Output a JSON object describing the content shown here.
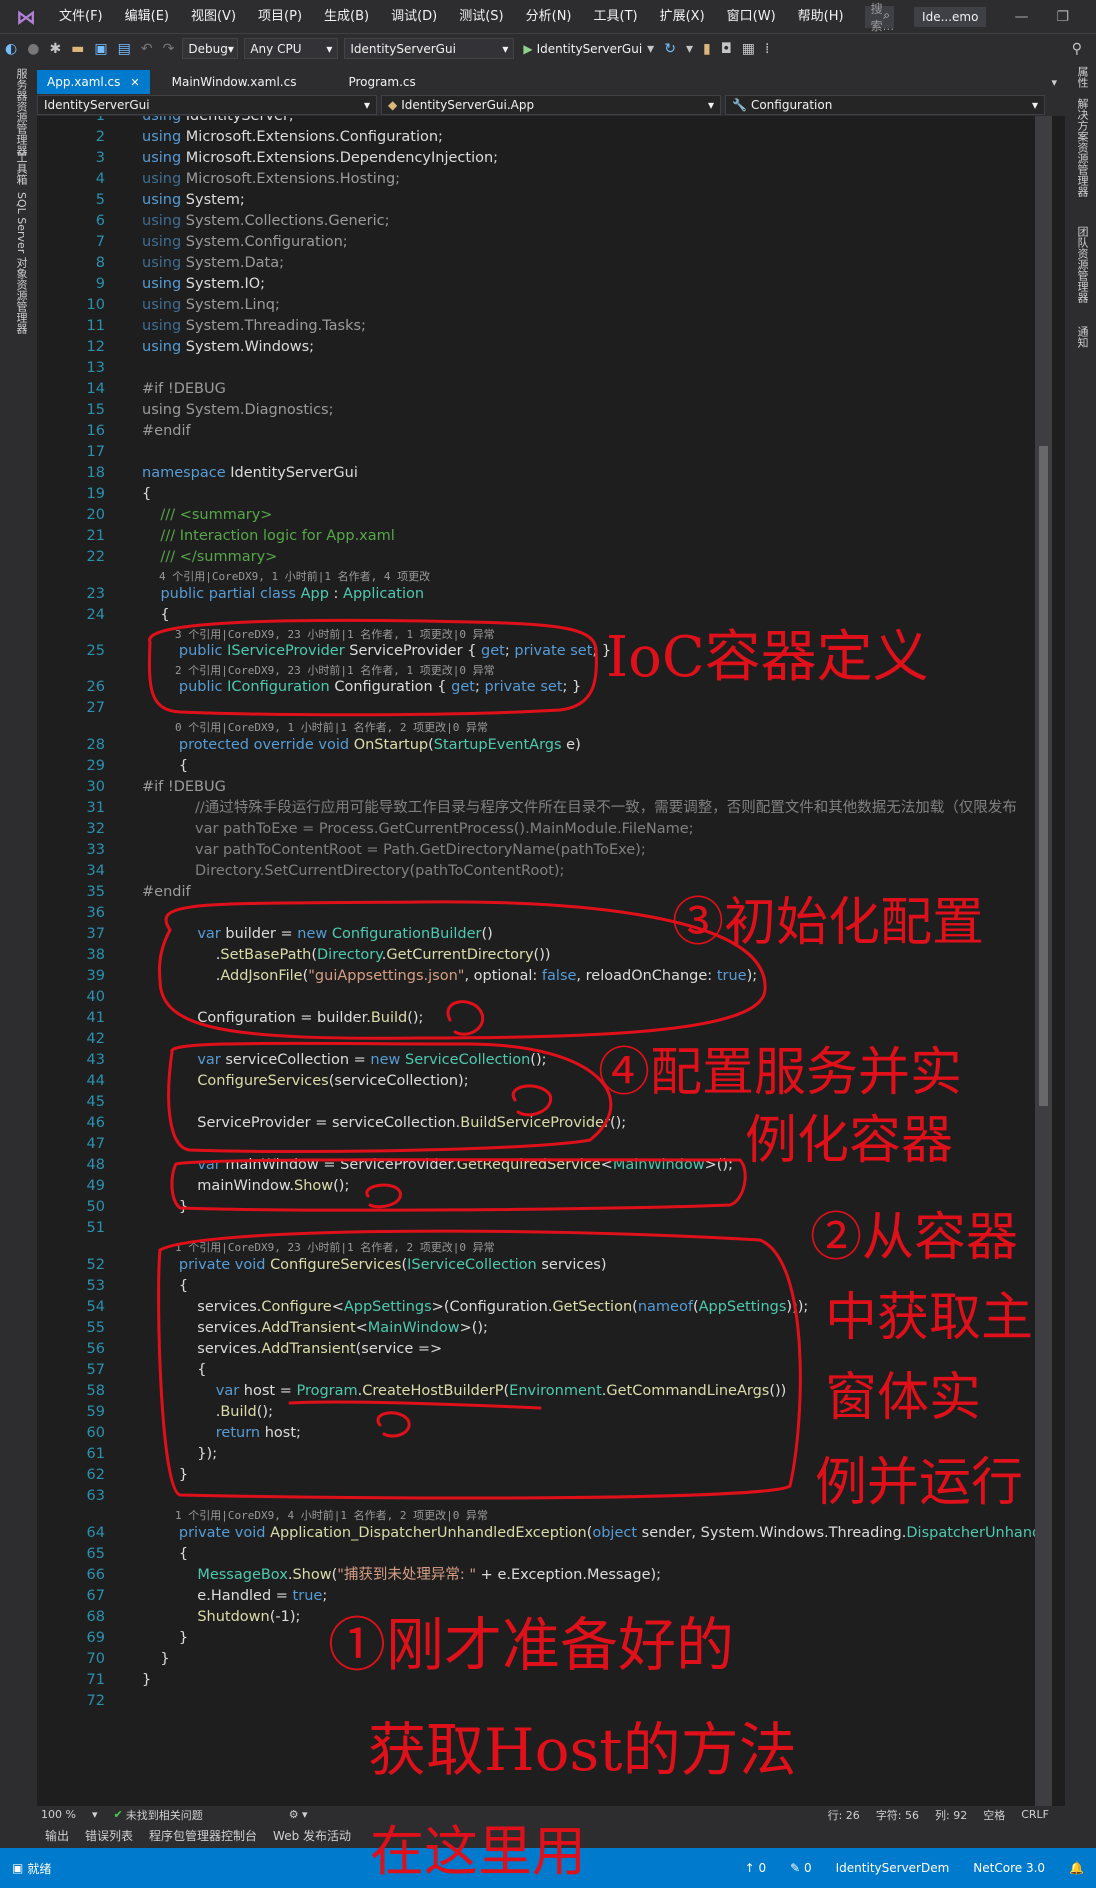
{
  "menubar": {
    "items": [
      "文件(F)",
      "编辑(E)",
      "视图(V)",
      "项目(P)",
      "生成(B)",
      "调试(D)",
      "测试(S)",
      "分析(N)",
      "工具(T)",
      "扩展(X)",
      "窗口(W)",
      "帮助(H)"
    ],
    "search_placeholder": "搜索...",
    "solution_name": "Ide...emo"
  },
  "toolbar": {
    "config": "Debug",
    "platform": "Any CPU",
    "startup_project": "IdentityServerGui",
    "run_label": "IdentityServerGui"
  },
  "left_rail": {
    "tabs": [
      "服务器资源管理器",
      "工具箱",
      "SQL Server 对象资源管理器"
    ]
  },
  "right_rail": {
    "tabs": [
      "属性",
      "解决方案资源管理器",
      "团队资源管理器",
      "通知"
    ]
  },
  "tabs": [
    {
      "label": "App.xaml.cs",
      "active": true
    },
    {
      "label": "MainWindow.xaml.cs",
      "active": false
    },
    {
      "label": "Program.cs",
      "active": false
    }
  ],
  "navbar": {
    "project": "IdentityServerGui",
    "type": "IdentityServerGui.App",
    "member": "Configuration"
  },
  "lenses": {
    "l1": "4 个引用|CoreDX9, 1 小时前|1 名作者, 4 项更改",
    "l2": "3 个引用|CoreDX9, 23 小时前|1 名作者, 1 项更改|0 异常",
    "l3": "2 个引用|CoreDX9, 23 小时前|1 名作者, 1 项更改|0 异常",
    "l4": "0 个引用|CoreDX9, 1 小时前|1 名作者, 2 项更改|0 异常",
    "l5": "1 个引用|CoreDX9, 23 小时前|1 名作者, 2 项更改|0 异常",
    "l6": "1 个引用|CoreDX9, 4 小时前|1 名作者, 2 项更改|0 异常"
  },
  "code": {
    "l31_comment": "//通过特殊手段运行应用可能导致工作目录与程序文件所在目录不一致，需要调整，否则配置文件和其他数据无法加载（仅限发布",
    "l32": "var pathToExe = Process.GetCurrentProcess().MainModule.FileName;",
    "l33": "var pathToContentRoot = Path.GetDirectoryName(pathToExe);",
    "l34": "Directory.SetCurrentDirectory(pathToContentRoot);",
    "l39_str": "\"guiAppsettings.json\"",
    "l66_str": "\"捕获到未处理异常: \""
  },
  "status_strip": {
    "zoom": "100 %",
    "issues": "未找到相关问题",
    "row": "行: 26",
    "col_char": "字符: 56",
    "col": "列: 92",
    "ws": "空格",
    "eol": "CRLF"
  },
  "bottom_tabs": [
    "输出",
    "错误列表",
    "程序包管理器控制台",
    "Web 发布活动"
  ],
  "statusbar": {
    "ready": "就绪",
    "up": "↑ 0",
    "pencil": "✎ 0",
    "repo": "IdentityServerDem",
    "branch": "NetCore 3.0"
  },
  "annotations": {
    "a1": "IoC容器定义",
    "a2": "③初始化配置",
    "a3": "④配置服务并实",
    "a3b": "例化容器",
    "a4": "②从容器",
    "a4b": "中获取主",
    "a4c": "窗体实",
    "a4d": "例并运行",
    "a5": "①刚才准备好的",
    "a5b": "获取Host的方法",
    "a5c": "在这里用"
  }
}
